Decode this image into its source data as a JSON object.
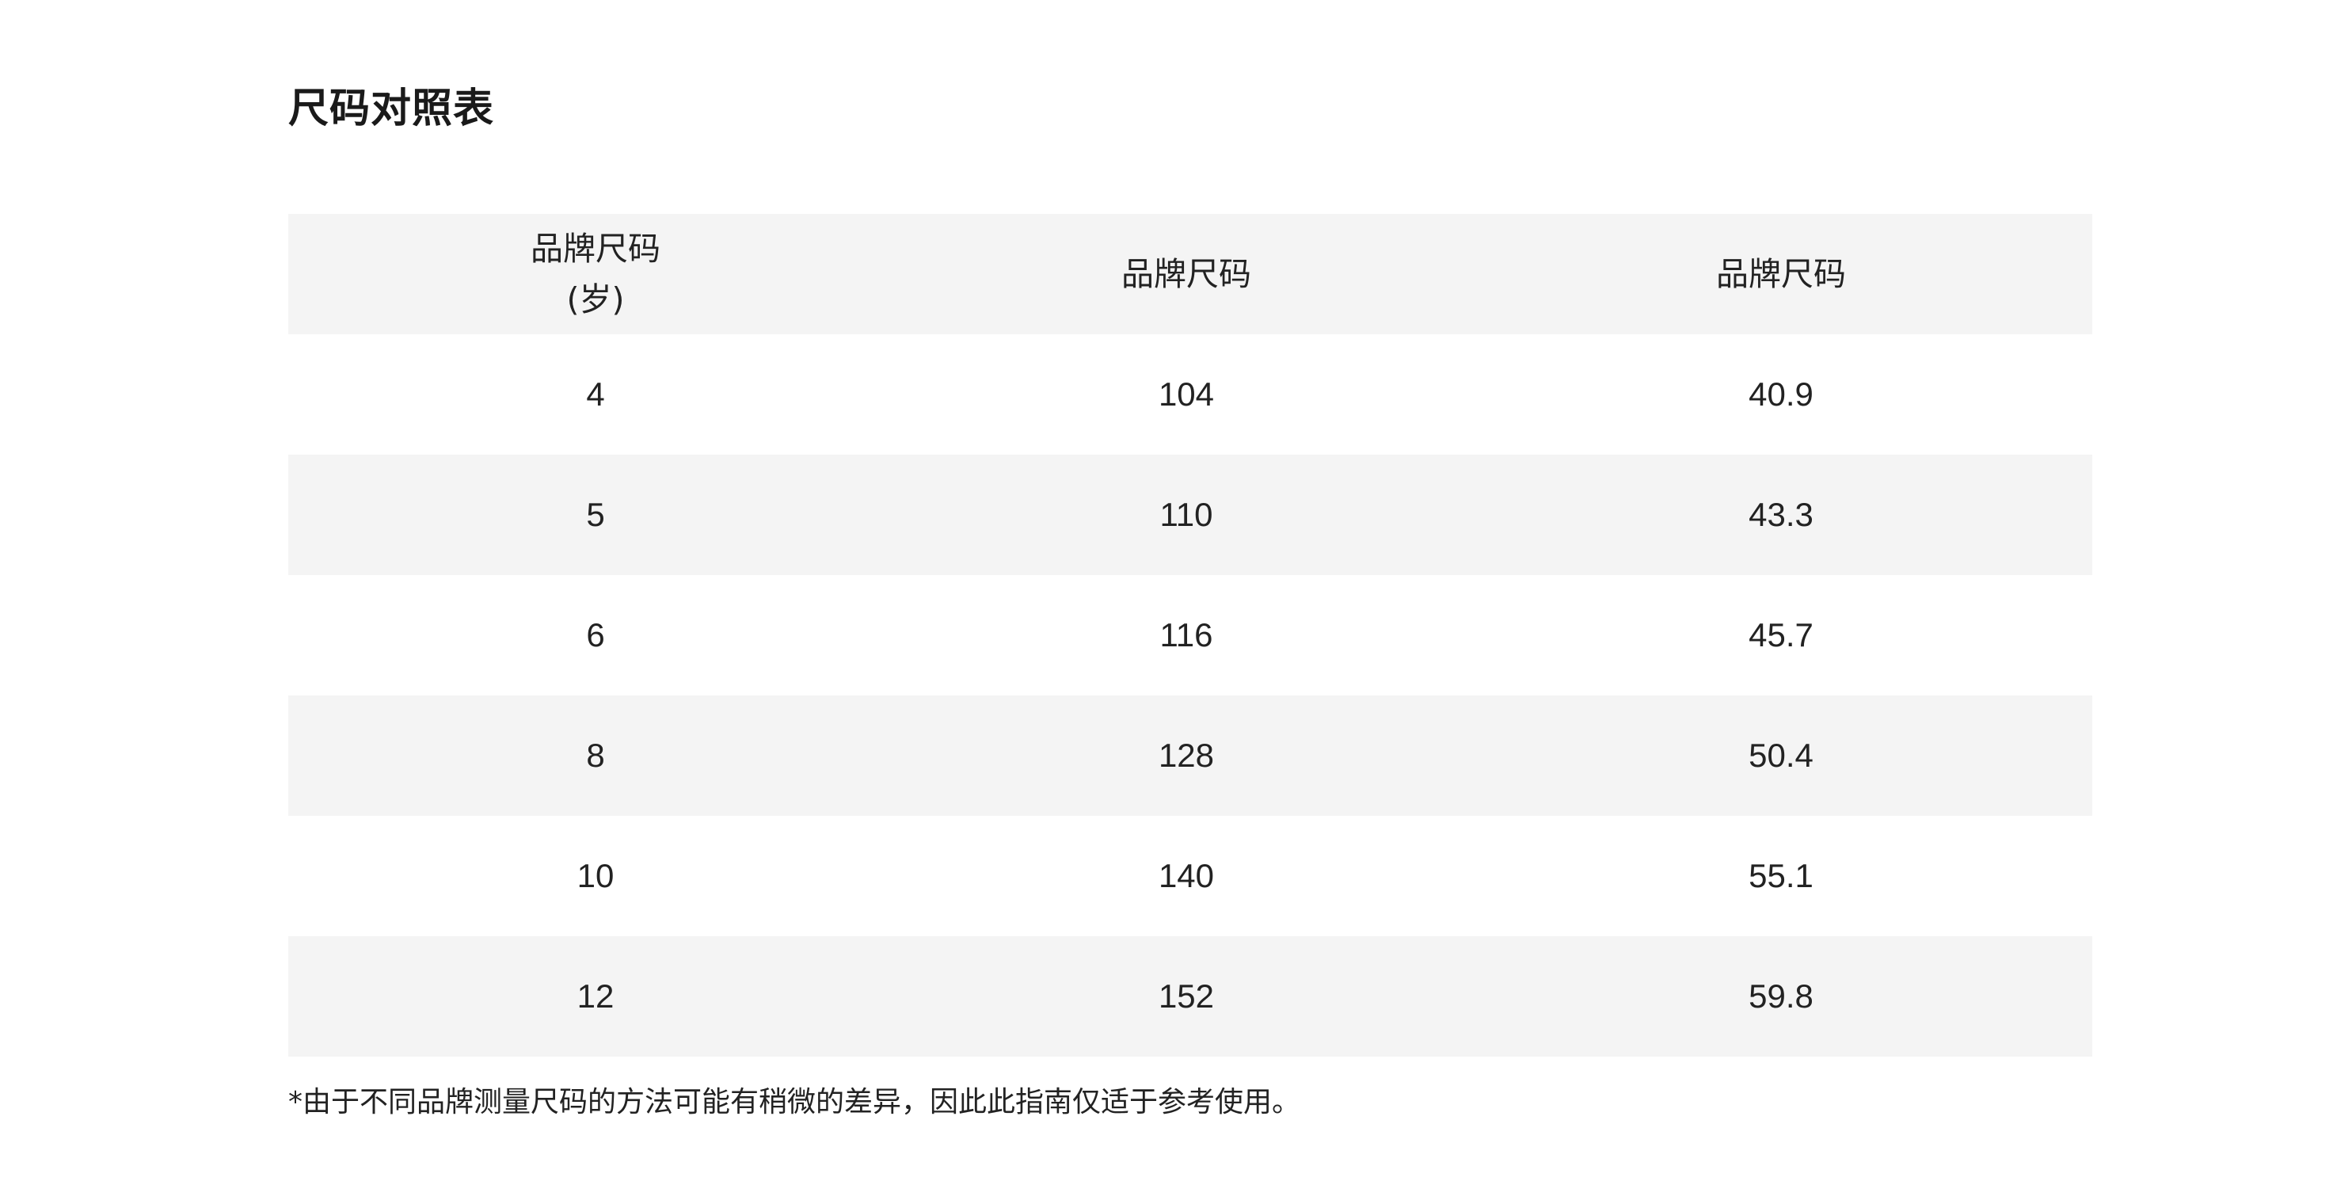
{
  "title": "尺码对照表",
  "table": {
    "headers": [
      {
        "line1": "品牌尺码",
        "line2": "(岁)"
      },
      {
        "line1": "品牌尺码",
        "line2": ""
      },
      {
        "line1": "品牌尺码",
        "line2": ""
      }
    ],
    "rows": [
      [
        "4",
        "104",
        "40.9"
      ],
      [
        "5",
        "110",
        "43.3"
      ],
      [
        "6",
        "116",
        "45.7"
      ],
      [
        "8",
        "128",
        "50.4"
      ],
      [
        "10",
        "140",
        "55.1"
      ],
      [
        "12",
        "152",
        "59.8"
      ]
    ]
  },
  "footnote": "*由于不同品牌测量尺码的方法可能有稍微的差异，因此此指南仅适于参考使用。",
  "colors": {
    "shaded_row": "#f4f4f4",
    "text": "#222222"
  }
}
